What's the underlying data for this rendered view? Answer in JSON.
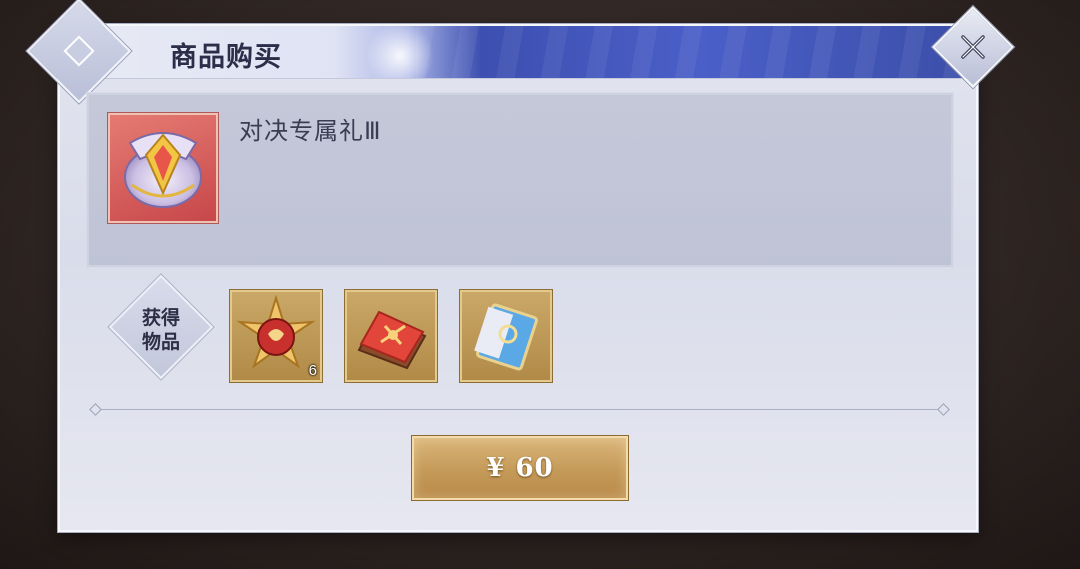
{
  "dialog": {
    "title": "商品购买"
  },
  "product": {
    "name": "对决专属礼Ⅲ",
    "icon": "gift-bag-icon"
  },
  "rewards": {
    "label": "获得物品",
    "items": [
      {
        "icon": "crimson-orb-icon",
        "count": "6"
      },
      {
        "icon": "red-scroll-book-icon",
        "count": ""
      },
      {
        "icon": "blue-card-icon",
        "count": ""
      }
    ]
  },
  "purchase": {
    "price_label": "¥ 60"
  },
  "colors": {
    "accent_gold": "#c59a58",
    "title_blue": "#3d4fb0",
    "panel_bg": "#e2e4ef"
  }
}
